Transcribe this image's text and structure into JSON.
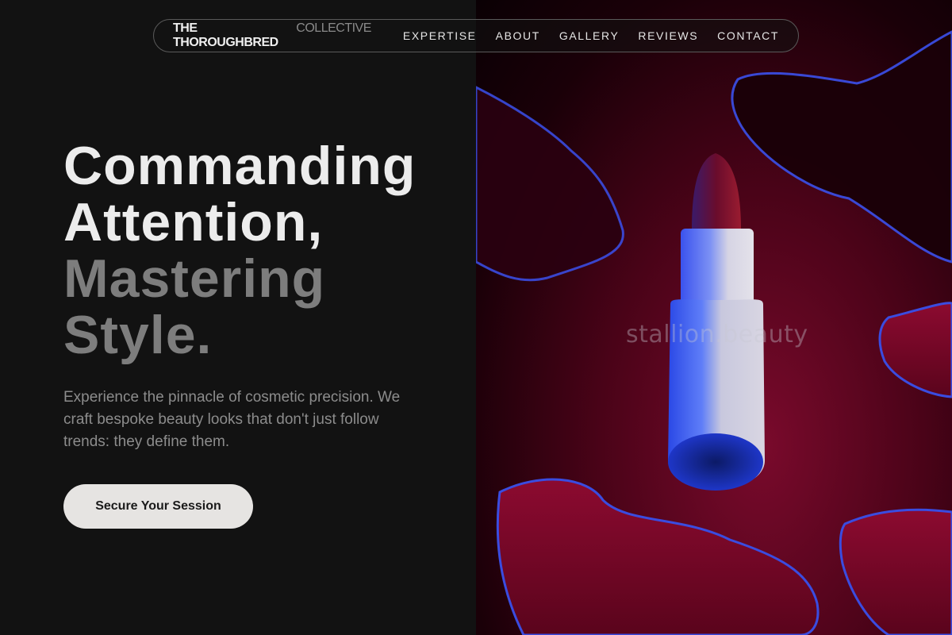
{
  "nav": {
    "brand_strong": "THE THOROUGHBRED",
    "brand_light": "COLLECTIVE",
    "links": [
      "EXPERTISE",
      "ABOUT",
      "GALLERY",
      "REVIEWS",
      "CONTACT"
    ]
  },
  "hero": {
    "headline": [
      "Commanding",
      "Attention,",
      "Mastering",
      "Style."
    ],
    "description": "Experience the pinnacle of cosmetic precision. We craft bespoke beauty looks that don't just follow trends: they define them.",
    "cta_label": "Secure Your Session"
  },
  "image": {
    "watermark": "stallion.beauty",
    "subject": "lipstick-icon"
  },
  "colors": {
    "background": "#121212",
    "headline_bright": "#ececec",
    "headline_dim": "#7d7d7d",
    "cta_bg": "#e6e4e2",
    "accent_red": "#8a0a30",
    "accent_blue": "#3a5cf0"
  }
}
